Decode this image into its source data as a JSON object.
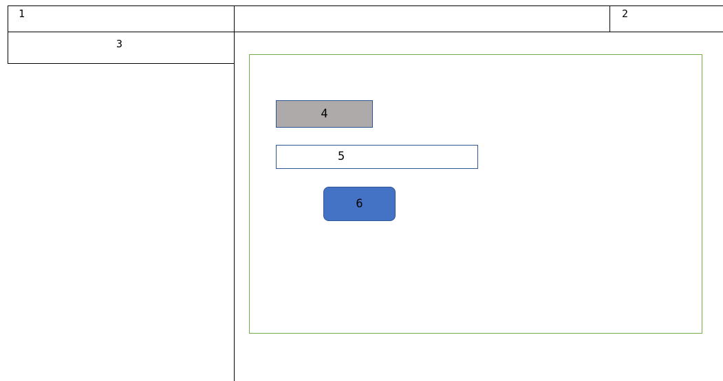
{
  "labels": {
    "header_left": "1",
    "header_right": "2",
    "sidebar_title": "3",
    "box_4": "4",
    "box_5": "5",
    "box_6": "6"
  },
  "colors": {
    "outline": "#000000",
    "content_border": "#70ad47",
    "box_4_fill": "#aeaaaa",
    "box_6_fill": "#4472c4",
    "box_border": "#2f5597"
  }
}
